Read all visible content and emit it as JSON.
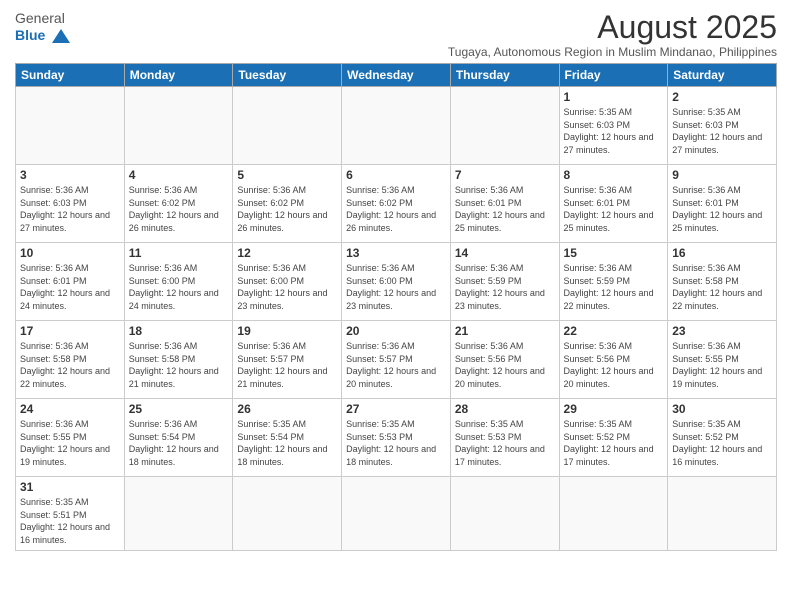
{
  "header": {
    "logo_general": "General",
    "logo_blue": "Blue",
    "month_title": "August 2025",
    "subtitle": "Tugaya, Autonomous Region in Muslim Mindanao, Philippines"
  },
  "weekdays": [
    "Sunday",
    "Monday",
    "Tuesday",
    "Wednesday",
    "Thursday",
    "Friday",
    "Saturday"
  ],
  "weeks": [
    [
      {
        "day": "",
        "info": ""
      },
      {
        "day": "",
        "info": ""
      },
      {
        "day": "",
        "info": ""
      },
      {
        "day": "",
        "info": ""
      },
      {
        "day": "",
        "info": ""
      },
      {
        "day": "1",
        "info": "Sunrise: 5:35 AM\nSunset: 6:03 PM\nDaylight: 12 hours and 27 minutes."
      },
      {
        "day": "2",
        "info": "Sunrise: 5:35 AM\nSunset: 6:03 PM\nDaylight: 12 hours and 27 minutes."
      }
    ],
    [
      {
        "day": "3",
        "info": "Sunrise: 5:36 AM\nSunset: 6:03 PM\nDaylight: 12 hours and 27 minutes."
      },
      {
        "day": "4",
        "info": "Sunrise: 5:36 AM\nSunset: 6:02 PM\nDaylight: 12 hours and 26 minutes."
      },
      {
        "day": "5",
        "info": "Sunrise: 5:36 AM\nSunset: 6:02 PM\nDaylight: 12 hours and 26 minutes."
      },
      {
        "day": "6",
        "info": "Sunrise: 5:36 AM\nSunset: 6:02 PM\nDaylight: 12 hours and 26 minutes."
      },
      {
        "day": "7",
        "info": "Sunrise: 5:36 AM\nSunset: 6:01 PM\nDaylight: 12 hours and 25 minutes."
      },
      {
        "day": "8",
        "info": "Sunrise: 5:36 AM\nSunset: 6:01 PM\nDaylight: 12 hours and 25 minutes."
      },
      {
        "day": "9",
        "info": "Sunrise: 5:36 AM\nSunset: 6:01 PM\nDaylight: 12 hours and 25 minutes."
      }
    ],
    [
      {
        "day": "10",
        "info": "Sunrise: 5:36 AM\nSunset: 6:01 PM\nDaylight: 12 hours and 24 minutes."
      },
      {
        "day": "11",
        "info": "Sunrise: 5:36 AM\nSunset: 6:00 PM\nDaylight: 12 hours and 24 minutes."
      },
      {
        "day": "12",
        "info": "Sunrise: 5:36 AM\nSunset: 6:00 PM\nDaylight: 12 hours and 23 minutes."
      },
      {
        "day": "13",
        "info": "Sunrise: 5:36 AM\nSunset: 6:00 PM\nDaylight: 12 hours and 23 minutes."
      },
      {
        "day": "14",
        "info": "Sunrise: 5:36 AM\nSunset: 5:59 PM\nDaylight: 12 hours and 23 minutes."
      },
      {
        "day": "15",
        "info": "Sunrise: 5:36 AM\nSunset: 5:59 PM\nDaylight: 12 hours and 22 minutes."
      },
      {
        "day": "16",
        "info": "Sunrise: 5:36 AM\nSunset: 5:58 PM\nDaylight: 12 hours and 22 minutes."
      }
    ],
    [
      {
        "day": "17",
        "info": "Sunrise: 5:36 AM\nSunset: 5:58 PM\nDaylight: 12 hours and 22 minutes."
      },
      {
        "day": "18",
        "info": "Sunrise: 5:36 AM\nSunset: 5:58 PM\nDaylight: 12 hours and 21 minutes."
      },
      {
        "day": "19",
        "info": "Sunrise: 5:36 AM\nSunset: 5:57 PM\nDaylight: 12 hours and 21 minutes."
      },
      {
        "day": "20",
        "info": "Sunrise: 5:36 AM\nSunset: 5:57 PM\nDaylight: 12 hours and 20 minutes."
      },
      {
        "day": "21",
        "info": "Sunrise: 5:36 AM\nSunset: 5:56 PM\nDaylight: 12 hours and 20 minutes."
      },
      {
        "day": "22",
        "info": "Sunrise: 5:36 AM\nSunset: 5:56 PM\nDaylight: 12 hours and 20 minutes."
      },
      {
        "day": "23",
        "info": "Sunrise: 5:36 AM\nSunset: 5:55 PM\nDaylight: 12 hours and 19 minutes."
      }
    ],
    [
      {
        "day": "24",
        "info": "Sunrise: 5:36 AM\nSunset: 5:55 PM\nDaylight: 12 hours and 19 minutes."
      },
      {
        "day": "25",
        "info": "Sunrise: 5:36 AM\nSunset: 5:54 PM\nDaylight: 12 hours and 18 minutes."
      },
      {
        "day": "26",
        "info": "Sunrise: 5:35 AM\nSunset: 5:54 PM\nDaylight: 12 hours and 18 minutes."
      },
      {
        "day": "27",
        "info": "Sunrise: 5:35 AM\nSunset: 5:53 PM\nDaylight: 12 hours and 18 minutes."
      },
      {
        "day": "28",
        "info": "Sunrise: 5:35 AM\nSunset: 5:53 PM\nDaylight: 12 hours and 17 minutes."
      },
      {
        "day": "29",
        "info": "Sunrise: 5:35 AM\nSunset: 5:52 PM\nDaylight: 12 hours and 17 minutes."
      },
      {
        "day": "30",
        "info": "Sunrise: 5:35 AM\nSunset: 5:52 PM\nDaylight: 12 hours and 16 minutes."
      }
    ],
    [
      {
        "day": "31",
        "info": "Sunrise: 5:35 AM\nSunset: 5:51 PM\nDaylight: 12 hours and 16 minutes."
      },
      {
        "day": "",
        "info": ""
      },
      {
        "day": "",
        "info": ""
      },
      {
        "day": "",
        "info": ""
      },
      {
        "day": "",
        "info": ""
      },
      {
        "day": "",
        "info": ""
      },
      {
        "day": "",
        "info": ""
      }
    ]
  ]
}
